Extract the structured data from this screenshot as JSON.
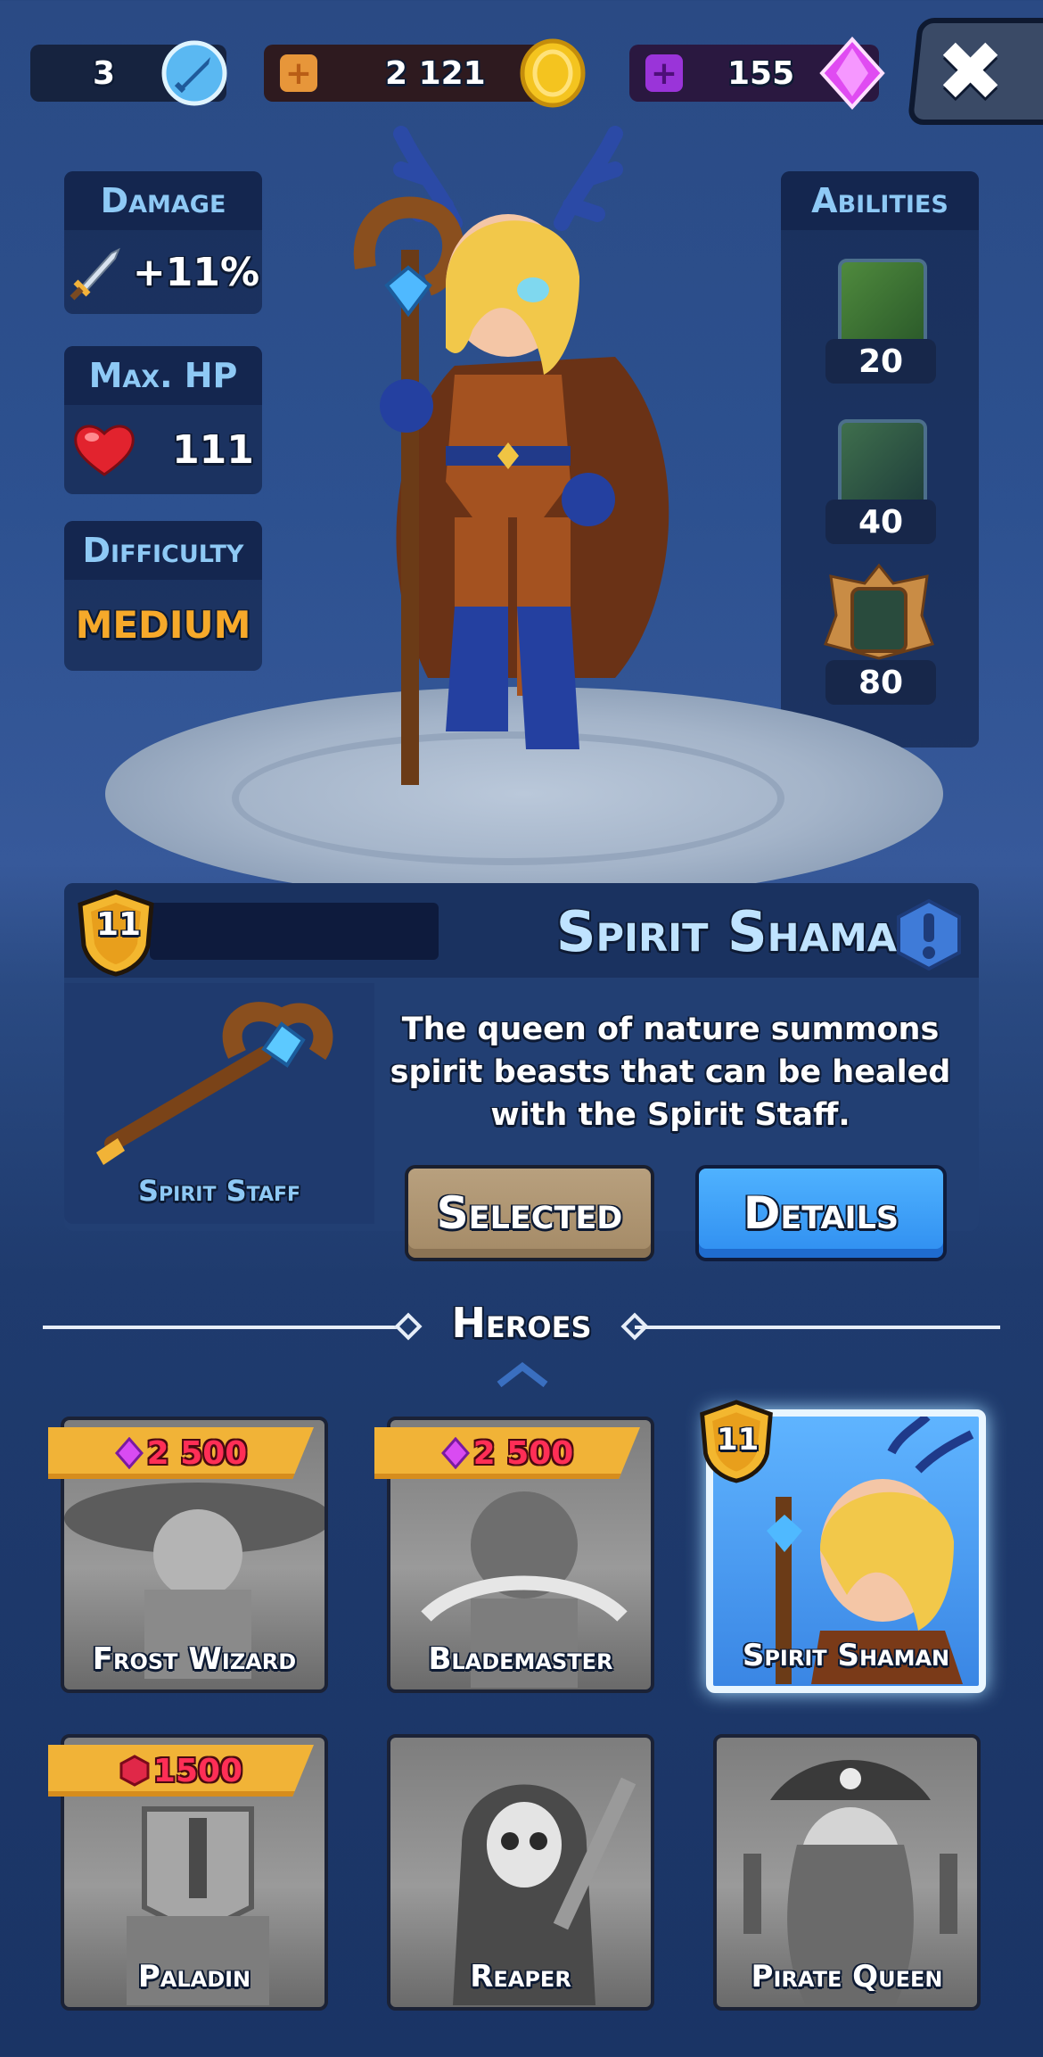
{
  "top_bar": {
    "sword_count": "3",
    "coins": "2 121",
    "gems": "155",
    "close_label": "✖"
  },
  "stats": {
    "damage": {
      "label": "Damage",
      "value": "+11%"
    },
    "max_hp": {
      "label": "Max. HP",
      "value": "111"
    },
    "difficulty": {
      "label": "Difficulty",
      "value": "MEDIUM"
    }
  },
  "abilities": {
    "label": "Abilities",
    "items": [
      {
        "icon": "vine-ability-icon",
        "cost": "20"
      },
      {
        "icon": "grass-ability-icon",
        "cost": "40"
      },
      {
        "icon": "totem-ability-icon",
        "cost": "80"
      }
    ]
  },
  "hero": {
    "level": "11",
    "name": "Spirit Shaman",
    "weapon_name": "Spirit Staff",
    "description": "The queen of nature summons spirit beasts that can be healed with the Spirit Staff.",
    "selected_label": "Selected",
    "details_label": "Details"
  },
  "heroes_section": {
    "title": "Heroes",
    "cards": [
      {
        "name": "Frost Wizard",
        "price": "2 500",
        "currency": "gem"
      },
      {
        "name": "Blademaster",
        "price": "2 500",
        "currency": "gem"
      },
      {
        "name": "Spirit Shaman",
        "level": "11",
        "selected": true
      },
      {
        "name": "Paladin",
        "price": "1500",
        "currency": "ruby"
      },
      {
        "name": "Reaper"
      },
      {
        "name": "Pirate Queen"
      }
    ]
  },
  "colors": {
    "accent_blue": "#4fb2ff",
    "gold": "#f1b337",
    "difficulty_orange": "#f6a92a",
    "heading_blue": "#8ec9f5"
  }
}
